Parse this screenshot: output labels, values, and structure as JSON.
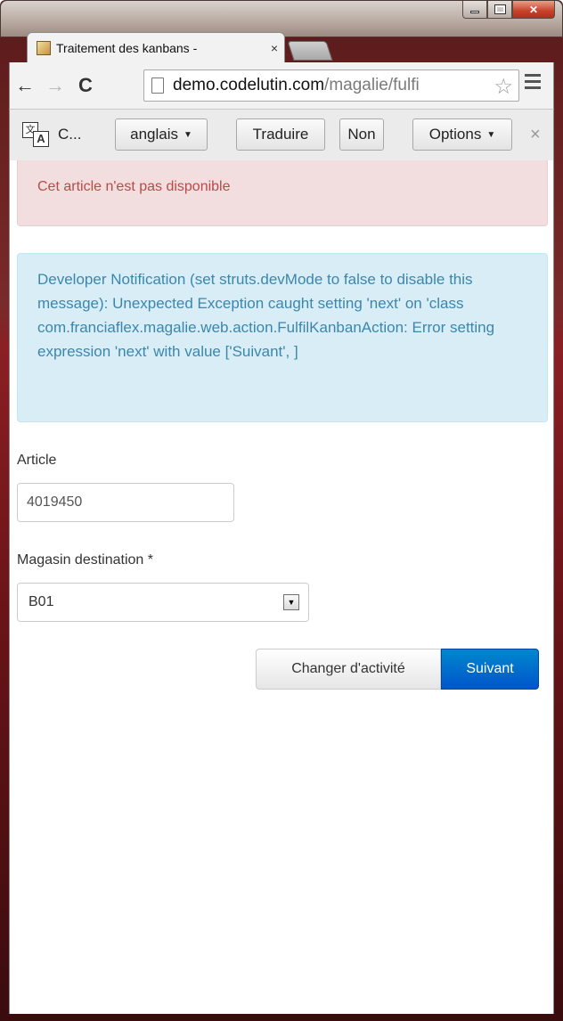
{
  "browser": {
    "tab_title": "Traitement des kanbans -",
    "tab_close": "×",
    "url_host": "demo.codelutin.com",
    "url_path": "/magalie/fulfi"
  },
  "translate_bar": {
    "language_label": "C...",
    "language_select": "anglais",
    "translate_button": "Traduire",
    "no_button": "Non",
    "options_button": "Options",
    "close": "×"
  },
  "alerts": {
    "danger": "Cet article n'est pas disponible",
    "info": "Developer Notification (set struts.devMode to false to disable this message): Unexpected Exception caught setting 'next' on 'class com.franciaflex.magalie.web.action.FulfilKanbanAction: Error setting expression 'next' with value ['Suivant', ]"
  },
  "form": {
    "article_label": "Article",
    "article_value": "4019450",
    "magasin_label": "Magasin destination *",
    "magasin_value": "B01"
  },
  "buttons": {
    "change_activity": "Changer d'activité",
    "next": "Suivant"
  }
}
